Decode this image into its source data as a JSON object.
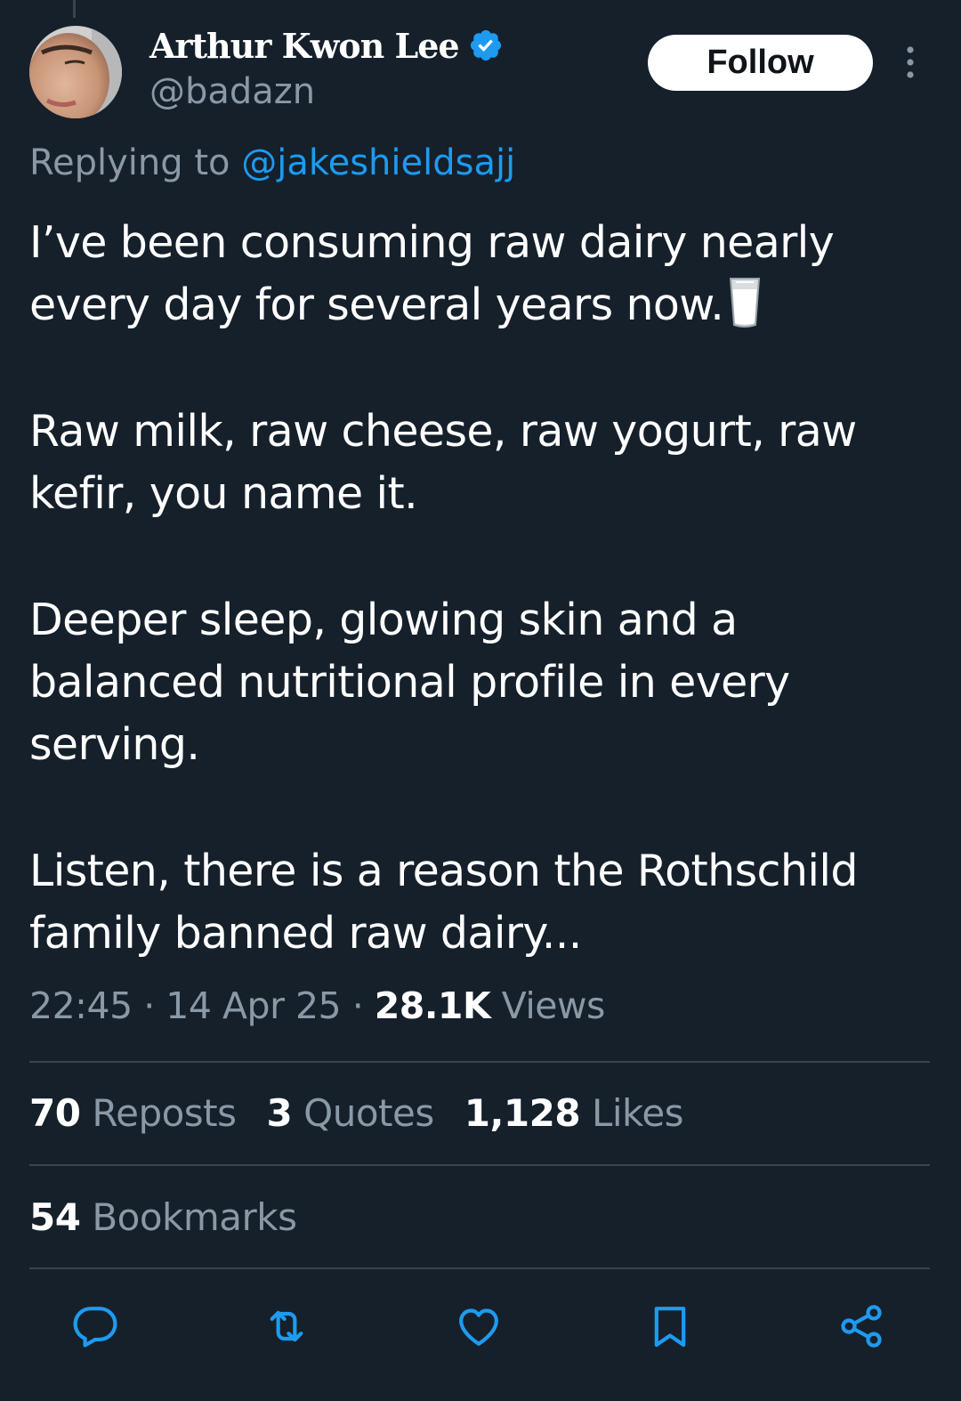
{
  "colors": {
    "background": "#15202b",
    "text_primary": "#ffffff",
    "text_secondary": "#8b98a5",
    "accent": "#1d9bf0",
    "divider": "#38444d"
  },
  "author": {
    "display_name": "Arthur Kwon Lee",
    "handle": "@badazn",
    "verified_icon": "verified-badge-icon",
    "avatar": "profile-photo"
  },
  "follow_label": "Follow",
  "more_icon": "more-vertical-icon",
  "reply": {
    "prefix": "Replying to",
    "mention": "@jakeshieldsajj"
  },
  "tweet": {
    "paragraphs": [
      "I’ve been consuming raw dairy nearly every day for several years now.",
      "Raw milk, raw cheese, raw yogurt, raw kefir, you name it.",
      "Deeper sleep, glowing skin and a balanced nutritional profile in every serving.",
      "Listen, there is a reason the Rothschild family banned raw dairy..."
    ],
    "emoji": "glass-of-milk-icon"
  },
  "meta": {
    "time": "22:45",
    "separator": "·",
    "date": "14 Apr 25",
    "views_count": "28.1K",
    "views_label": "Views"
  },
  "stats": {
    "reposts_count": "70",
    "reposts_label": "Reposts",
    "quotes_count": "3",
    "quotes_label": "Quotes",
    "likes_count": "1,128",
    "likes_label": "Likes",
    "bookmarks_count": "54",
    "bookmarks_label": "Bookmarks"
  },
  "actions": [
    "reply-icon",
    "repost-icon",
    "like-icon",
    "bookmark-icon",
    "share-icon"
  ]
}
